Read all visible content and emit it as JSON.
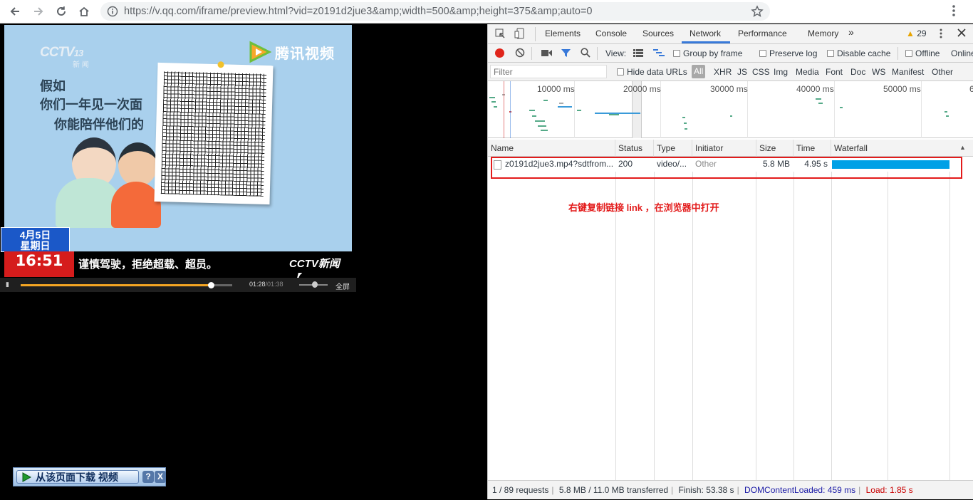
{
  "browser": {
    "url": "https://v.qq.com/iframe/preview.html?vid=z0191d2jue3&amp;width=500&amp;height=375&amp;auto=0"
  },
  "video": {
    "channel_logo": "CCTV",
    "channel_num": "13",
    "channel_sub": "新 闻",
    "brand": "腾讯视频",
    "caption_lines": [
      "假如",
      "你们一年见一次面",
      "你能陪伴他们的"
    ],
    "date": "4月5日",
    "weekday": "星期日",
    "clock": "16:51",
    "ticker": "谨慎驾驶，拒绝超载、超员。",
    "ticker_logo": "CCTV新闻 【",
    "time_current": "01:28",
    "time_total": "/01:38",
    "progress": 0.9,
    "volume": 0.45,
    "fullscreen": "全屏"
  },
  "download_bar": {
    "label": "从该页面下载 视频",
    "help": "?",
    "close": "X"
  },
  "devtools": {
    "tabs": [
      "Elements",
      "Console",
      "Sources",
      "Network",
      "Performance",
      "Memory"
    ],
    "active_tab": "Network",
    "more": "»",
    "warnings": "29",
    "toolbar": {
      "view": "View:",
      "group_by_frame": "Group by frame",
      "preserve_log": "Preserve log",
      "disable_cache": "Disable cache",
      "offline": "Offline",
      "online": "Online"
    },
    "filter": {
      "placeholder": "Filter",
      "hide_data_urls": "Hide data URLs",
      "types": [
        "All",
        "XHR",
        "JS",
        "CSS",
        "Img",
        "Media",
        "Font",
        "Doc",
        "WS",
        "Manifest",
        "Other"
      ]
    },
    "overview_labels": [
      "10000 ms",
      "20000 ms",
      "30000 ms",
      "40000 ms",
      "50000 ms",
      "6"
    ],
    "columns": [
      "Name",
      "Status",
      "Type",
      "Initiator",
      "Size",
      "Time",
      "Waterfall"
    ],
    "rows": [
      {
        "name": "z0191d2jue3.mp4?sdtfrom...",
        "status": "200",
        "type": "video/...",
        "initiator": "Other",
        "size": "5.8 MB",
        "time": "4.95 s"
      }
    ],
    "annotation": "右键复制链接 link ，在浏览器中打开",
    "status_bar": {
      "requests": "1 / 89 requests",
      "transferred": "5.8 MB / 11.0 MB transferred",
      "finish": "Finish: 53.38 s",
      "dcl": "DOMContentLoaded: 459 ms",
      "load": "Load: 1.85 s"
    },
    "colors": {
      "dcl": "#1a1aa6",
      "load": "#c80000",
      "waterfall": "#00a0e6",
      "record": "#e0251b"
    }
  }
}
